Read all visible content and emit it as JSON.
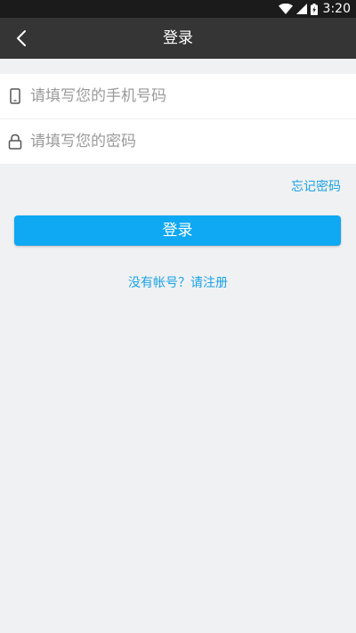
{
  "status_bar": {
    "time": "3:20",
    "icons": [
      "wifi-icon",
      "cell-signal-icon",
      "battery-icon"
    ]
  },
  "header": {
    "title": "登录",
    "back_icon": "chevron-left-icon"
  },
  "form": {
    "phone": {
      "icon": "phone-icon",
      "value": "",
      "placeholder": "请填写您的手机号码"
    },
    "password": {
      "icon": "lock-icon",
      "value": "",
      "placeholder": "请填写您的密码"
    }
  },
  "links": {
    "forgot_password": "忘记密码",
    "register": "没有帐号？请注册"
  },
  "buttons": {
    "login": "登录"
  },
  "colors": {
    "status_bar": "#1b1b1b",
    "app_bar": "#353535",
    "accent": "#0fa8f2",
    "link": "#1aa3e6",
    "background": "#f0f1f3"
  }
}
